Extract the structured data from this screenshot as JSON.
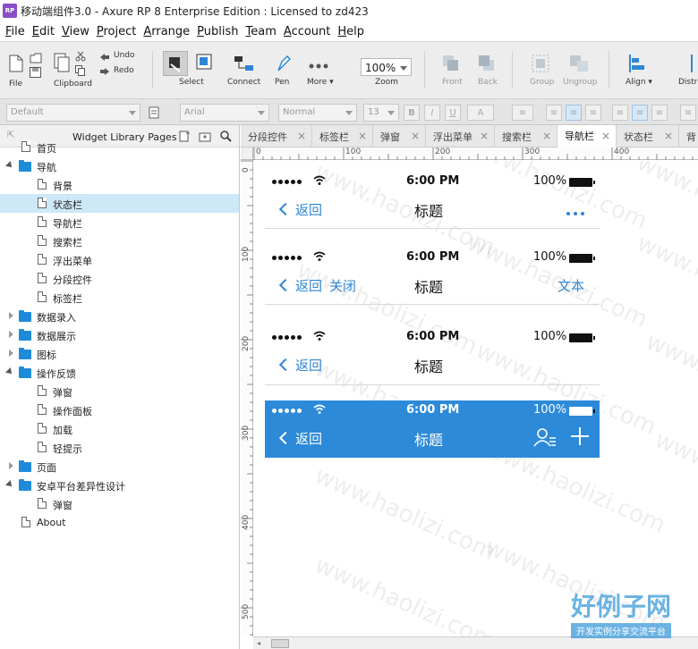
{
  "window": {
    "title": "移动端组件3.0 - Axure RP 8 Enterprise Edition : Licensed to zd423",
    "app_icon": "RP"
  },
  "menu": [
    {
      "pre": "",
      "ul": "F",
      "post": "ile"
    },
    {
      "pre": "",
      "ul": "E",
      "post": "dit"
    },
    {
      "pre": "",
      "ul": "V",
      "post": "iew"
    },
    {
      "pre": "",
      "ul": "P",
      "post": "roject"
    },
    {
      "pre": "",
      "ul": "A",
      "post": "rrange"
    },
    {
      "pre": "",
      "ul": "P",
      "post": "ublish"
    },
    {
      "pre": "",
      "ul": "T",
      "post": "eam"
    },
    {
      "pre": "",
      "ul": "A",
      "post": "ccount"
    },
    {
      "pre": "",
      "ul": "H",
      "post": "elp"
    }
  ],
  "toolbar": {
    "file": "File",
    "clipboard": "Clipboard",
    "undo": "Undo",
    "redo": "Redo",
    "select": "Select",
    "connect": "Connect",
    "pen": "Pen",
    "more": "More ▾",
    "zoom_value": "100%",
    "zoom": "Zoom",
    "front": "Front",
    "back": "Back",
    "group": "Group",
    "ungroup": "Ungroup",
    "align": "Align ▾",
    "distribute": "Distri"
  },
  "formatbar": {
    "style": "Default",
    "font": "Arial",
    "weight": "Normal",
    "size": "13",
    "bold": "B",
    "italic": "I",
    "underline": "U",
    "font_color": "A"
  },
  "left_panel": {
    "title": "Widget Library Pages",
    "items": [
      {
        "label": "首页",
        "type": "page",
        "level": 1
      },
      {
        "label": "导航",
        "type": "folder",
        "level": 0,
        "expanded": true
      },
      {
        "label": "背景",
        "type": "page",
        "level": 2
      },
      {
        "label": "状态栏",
        "type": "page",
        "level": 2,
        "selected": true
      },
      {
        "label": "导航栏",
        "type": "page",
        "level": 2
      },
      {
        "label": "搜索栏",
        "type": "page",
        "level": 2
      },
      {
        "label": "浮出菜单",
        "type": "page",
        "level": 2
      },
      {
        "label": "分段控件",
        "type": "page",
        "level": 2
      },
      {
        "label": "标签栏",
        "type": "page",
        "level": 2
      },
      {
        "label": "数据录入",
        "type": "folder",
        "level": 0,
        "expanded": false
      },
      {
        "label": "数据展示",
        "type": "folder",
        "level": 0,
        "expanded": false
      },
      {
        "label": "图标",
        "type": "folder",
        "level": 0,
        "expanded": false
      },
      {
        "label": "操作反馈",
        "type": "folder",
        "level": 0,
        "expanded": true
      },
      {
        "label": "弹窗",
        "type": "page",
        "level": 2
      },
      {
        "label": "操作面板",
        "type": "page",
        "level": 2
      },
      {
        "label": "加载",
        "type": "page",
        "level": 2
      },
      {
        "label": "轻提示",
        "type": "page",
        "level": 2
      },
      {
        "label": "页面",
        "type": "folder",
        "level": 0,
        "expanded": false
      },
      {
        "label": "安卓平台差异性设计",
        "type": "folder",
        "level": 0,
        "expanded": true
      },
      {
        "label": "弹窗",
        "type": "page",
        "level": 2
      },
      {
        "label": "About",
        "type": "page",
        "level": 1
      }
    ]
  },
  "tabs": [
    "分段控件",
    "标签栏",
    "弹窗",
    "浮出菜单",
    "搜索栏",
    "导航栏",
    "状态栏",
    "背"
  ],
  "ruler": {
    "h": [
      "0",
      "100",
      "200",
      "300",
      "400"
    ],
    "v": [
      "0",
      "100",
      "200",
      "300",
      "400",
      "500"
    ]
  },
  "navbars": [
    {
      "time": "6:00 PM",
      "battery": "100%",
      "back": "返回",
      "close": "",
      "title": "标题",
      "right_text": "",
      "right": "more-dots",
      "style": "light"
    },
    {
      "time": "6:00 PM",
      "battery": "100%",
      "back": "返回",
      "close": "关闭",
      "title": "标题",
      "right_text": "文本",
      "right": "text",
      "style": "light"
    },
    {
      "time": "6:00 PM",
      "battery": "100%",
      "back": "返回",
      "close": "",
      "title": "标题",
      "right_text": "",
      "right": "none",
      "style": "light"
    },
    {
      "time": "6:00 PM",
      "battery": "100%",
      "back": "返回",
      "close": "",
      "title": "标题",
      "right_text": "",
      "right": "icons",
      "style": "blue"
    }
  ],
  "colors": {
    "accent": "#2e86d4",
    "bar_blue": "#2d8ad9",
    "selected_row": "#cde8f6"
  },
  "watermark": {
    "text": "www.haolizi.com",
    "logo": "好例子网",
    "logo_sub": "开发实例分享交流平台"
  }
}
